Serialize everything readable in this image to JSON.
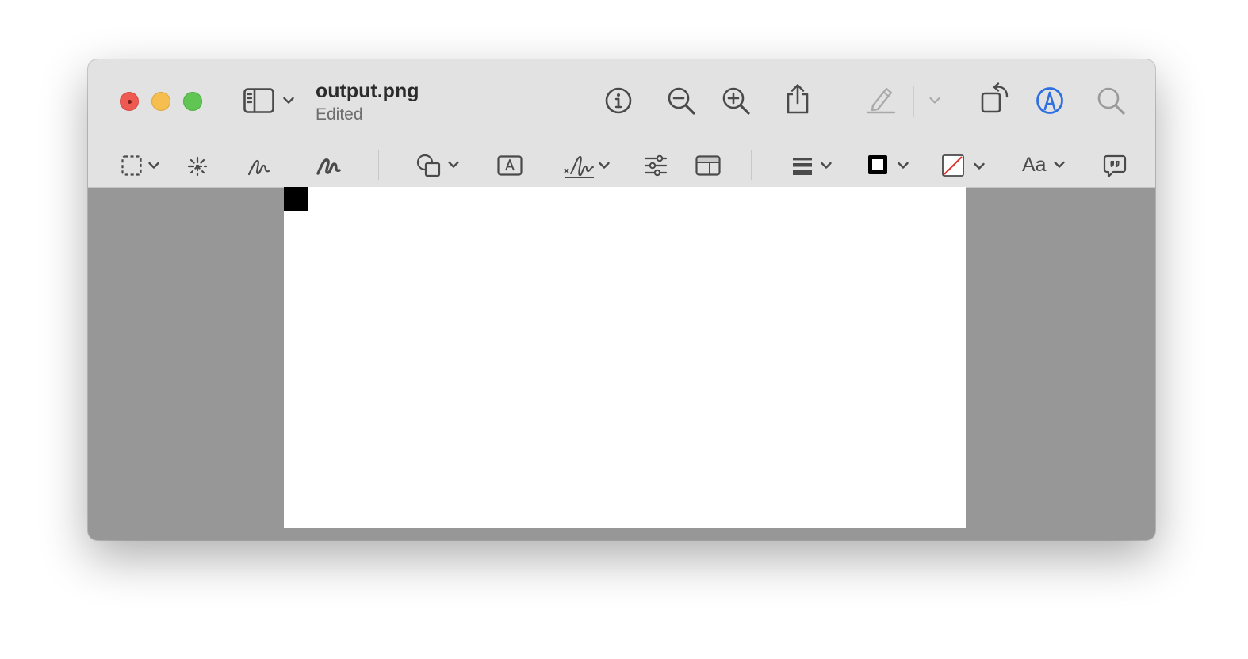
{
  "window": {
    "title": "output.png",
    "subtitle": "Edited"
  },
  "toolbar": {
    "top": [
      {
        "name": "sidebar-toggle",
        "icon": "sidebar-icon"
      },
      {
        "name": "info",
        "icon": "info-icon"
      },
      {
        "name": "zoom-out",
        "icon": "zoom-out-icon"
      },
      {
        "name": "zoom-in",
        "icon": "zoom-in-icon"
      },
      {
        "name": "share",
        "icon": "share-icon"
      },
      {
        "name": "highlight",
        "icon": "highlighter-icon",
        "enabled": false
      },
      {
        "name": "rotate",
        "icon": "rotate-icon"
      },
      {
        "name": "markup",
        "icon": "markup-icon",
        "active": true
      },
      {
        "name": "search",
        "icon": "search-icon"
      }
    ],
    "markup": [
      {
        "name": "selection-tools",
        "icon": "rect-selection-icon"
      },
      {
        "name": "instant-alpha",
        "icon": "magic-wand-icon"
      },
      {
        "name": "sketch",
        "icon": "sketch-icon"
      },
      {
        "name": "draw",
        "icon": "draw-icon"
      },
      {
        "name": "shapes",
        "icon": "shapes-icon"
      },
      {
        "name": "text",
        "icon": "text-box-icon"
      },
      {
        "name": "sign",
        "icon": "signature-icon"
      },
      {
        "name": "adjust-color",
        "icon": "sliders-icon"
      },
      {
        "name": "adjust-size",
        "icon": "resize-icon"
      },
      {
        "name": "shape-style",
        "icon": "line-weight-icon"
      },
      {
        "name": "border-color",
        "icon": "border-color-icon"
      },
      {
        "name": "fill-color",
        "icon": "fill-color-icon"
      },
      {
        "name": "text-style",
        "icon": "text-style-icon",
        "label": "Aa"
      },
      {
        "name": "annotate",
        "icon": "speech-bubble-icon"
      }
    ]
  },
  "colors": {
    "window_bg": "#979797",
    "toolbar_bg": "#e2e2e2",
    "accent": "#2f6fe0",
    "close": "#ee5a52",
    "minimize": "#f6be4f",
    "zoom": "#61c554"
  }
}
